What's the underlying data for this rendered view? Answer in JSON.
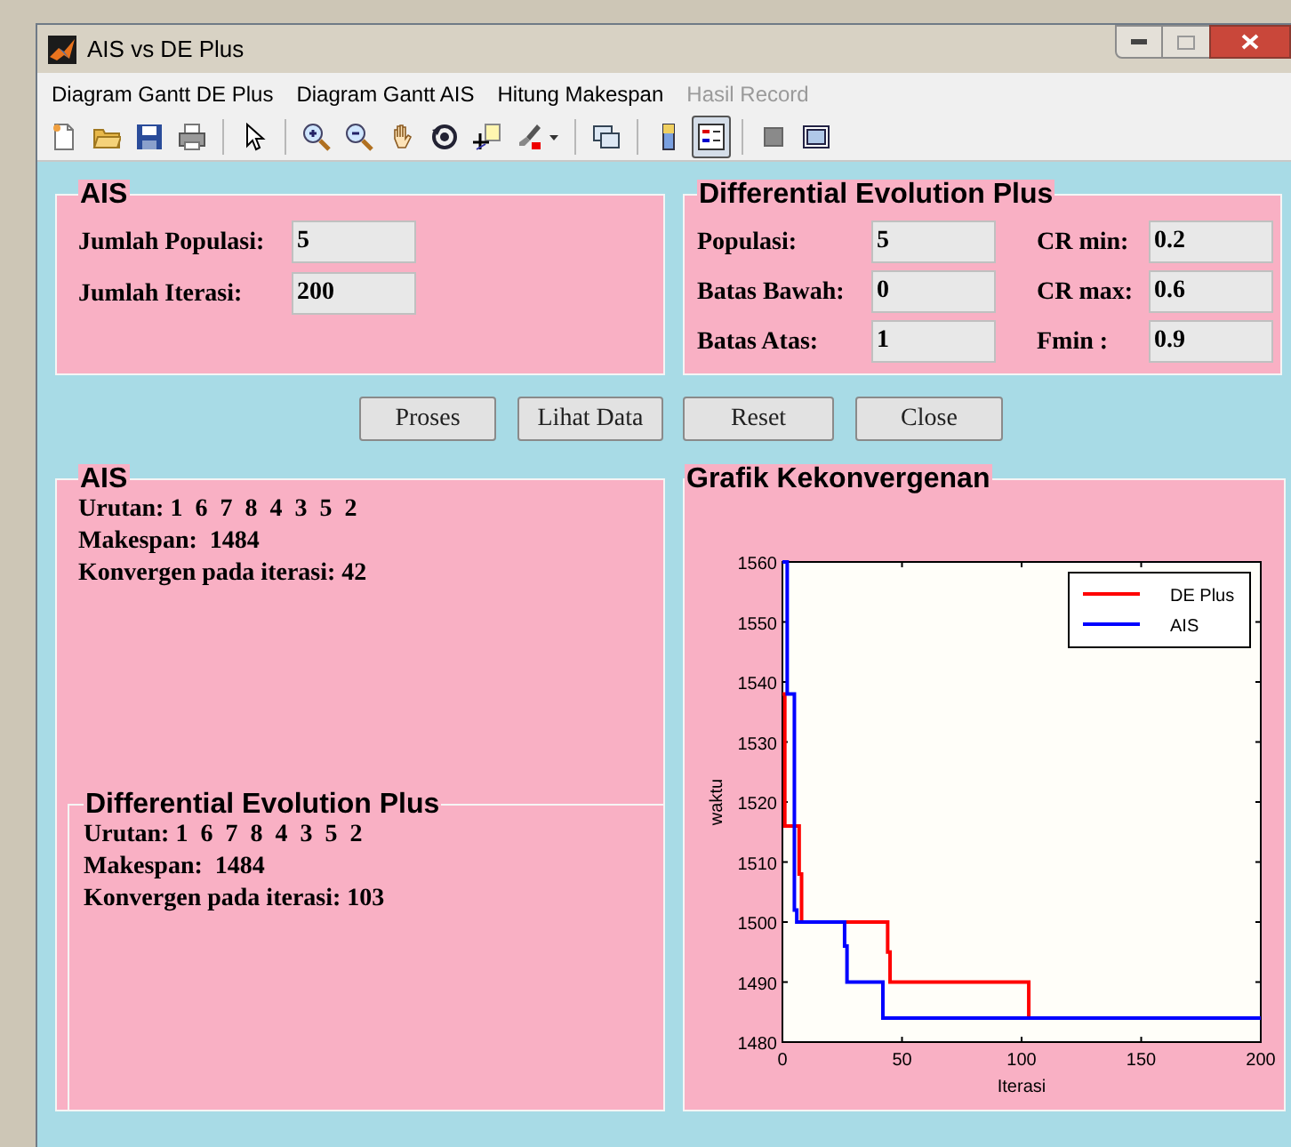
{
  "window": {
    "title": "AIS vs DE Plus"
  },
  "menu": [
    {
      "label": "Diagram Gantt DE Plus",
      "disabled": false
    },
    {
      "label": "Diagram Gantt AIS",
      "disabled": false
    },
    {
      "label": "Hitung Makespan",
      "disabled": false
    },
    {
      "label": "Hasil Record",
      "disabled": true
    }
  ],
  "toolbar": [
    {
      "kind": "new",
      "selected": false
    },
    {
      "kind": "open",
      "selected": false
    },
    {
      "kind": "save",
      "selected": false
    },
    {
      "kind": "print",
      "selected": false
    },
    {
      "kind": "separator"
    },
    {
      "kind": "pointer",
      "selected": false
    },
    {
      "kind": "separator"
    },
    {
      "kind": "zoom-in",
      "selected": false
    },
    {
      "kind": "zoom-out",
      "selected": false
    },
    {
      "kind": "pan",
      "selected": false
    },
    {
      "kind": "rotate",
      "selected": false
    },
    {
      "kind": "data-cursor",
      "selected": false
    },
    {
      "kind": "brush",
      "selected": false
    },
    {
      "kind": "separator"
    },
    {
      "kind": "link",
      "selected": false
    },
    {
      "kind": "separator"
    },
    {
      "kind": "colorbar",
      "selected": false
    },
    {
      "kind": "legend",
      "selected": true
    },
    {
      "kind": "separator"
    },
    {
      "kind": "hide-plot",
      "selected": false
    },
    {
      "kind": "show-plot",
      "selected": false
    }
  ],
  "ais_input": {
    "title": "AIS",
    "fields": [
      {
        "label": "Jumlah Populasi:",
        "value": "5"
      },
      {
        "label": "Jumlah Iterasi:",
        "value": "200"
      }
    ]
  },
  "de_input": {
    "title": "Differential Evolution Plus",
    "fields": [
      {
        "label": "Populasi:",
        "value": "5"
      },
      {
        "label": "CR min:",
        "value": "0.2"
      },
      {
        "label": "Batas Bawah:",
        "value": "0"
      },
      {
        "label": "CR max:",
        "value": "0.6"
      },
      {
        "label": "Batas Atas:",
        "value": "1"
      },
      {
        "label": "Fmin :",
        "value": "0.9"
      }
    ]
  },
  "buttons": [
    "Proses",
    "Lihat Data",
    "Reset",
    "Close"
  ],
  "ais_result": {
    "title": "AIS",
    "lines": [
      "Urutan: 1  6  7  8  4  3  5  2",
      "Makespan:  1484",
      "Konvergen pada iterasi: 42"
    ]
  },
  "de_result": {
    "title": "Differential Evolution Plus",
    "lines": [
      "Urutan: 1  6  7  8  4  3  5  2",
      "Makespan:  1484",
      "Konvergen pada iterasi: 103"
    ]
  },
  "chart_panel": {
    "title": "Grafik Kekonvergenan",
    "chart_data": {
      "type": "line",
      "xlabel": "Iterasi",
      "ylabel": "waktu",
      "x": [
        0,
        1,
        1,
        2,
        2,
        5,
        5,
        6,
        6,
        7,
        7,
        8,
        8,
        26,
        26,
        27,
        27,
        42,
        42,
        44,
        44,
        45,
        45,
        103,
        103,
        200
      ],
      "series": [
        {
          "name": "DE Plus",
          "color": "#ff0000",
          "values": [
            1538,
            1538,
            1516,
            1516,
            1516,
            1516,
            1516,
            1516,
            1516,
            1516,
            1508,
            1508,
            1500,
            1500,
            1500,
            1500,
            1500,
            1500,
            1500,
            1500,
            1495,
            1495,
            1490,
            1490,
            1484,
            null
          ]
        },
        {
          "name": "AIS",
          "color": "#0000ff",
          "values": [
            1560,
            1560,
            1560,
            1560,
            1538,
            1538,
            1502,
            1502,
            1500,
            1500,
            1500,
            1500,
            1500,
            1500,
            1496,
            1496,
            1490,
            1490,
            1484,
            1484,
            1484,
            1484,
            1484,
            1484,
            1484,
            1484
          ]
        }
      ],
      "legend": true,
      "xlim": [
        0,
        200
      ],
      "ylim": [
        1480,
        1560
      ],
      "xticks": [
        0,
        50,
        100,
        150,
        200
      ],
      "yticks": [
        1480,
        1490,
        1500,
        1510,
        1520,
        1530,
        1540,
        1550,
        1560
      ]
    }
  }
}
